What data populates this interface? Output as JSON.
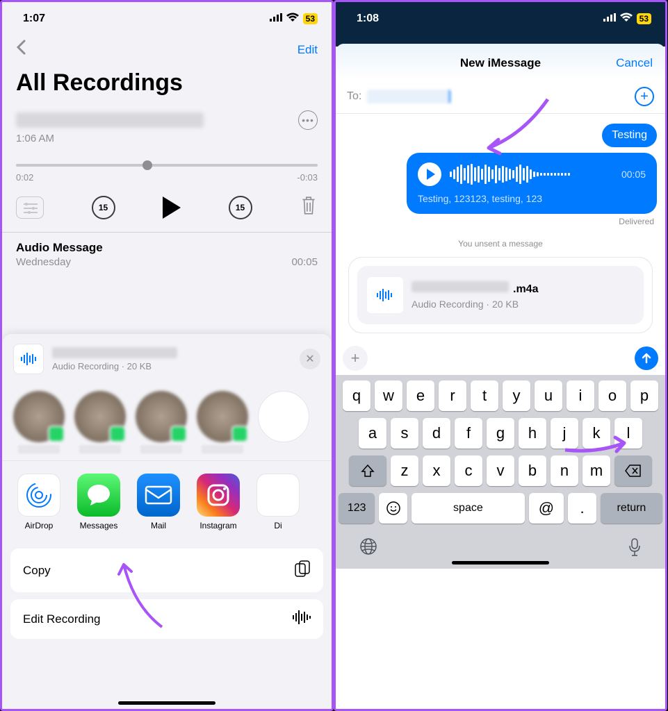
{
  "left": {
    "status": {
      "time": "1:07",
      "battery": "53"
    },
    "nav": {
      "edit": "Edit"
    },
    "title": "All Recordings",
    "current_recording": {
      "time": "1:06 AM",
      "elapsed": "0:02",
      "remaining": "-0:03",
      "skip_back": "15",
      "skip_fwd": "15"
    },
    "second_recording": {
      "title": "Audio Message",
      "day": "Wednesday",
      "duration": "00:05"
    },
    "share": {
      "file_subtitle": "Audio Recording · 20 KB",
      "apps": {
        "airdrop": "AirDrop",
        "messages": "Messages",
        "mail": "Mail",
        "instagram": "Instagram",
        "partial": "Di"
      },
      "actions": {
        "copy": "Copy",
        "edit": "Edit Recording"
      }
    }
  },
  "right": {
    "status": {
      "time": "1:08",
      "battery": "53"
    },
    "nav": {
      "title": "New iMessage",
      "cancel": "Cancel"
    },
    "to_label": "To:",
    "chat": {
      "bubble1": "Testing",
      "audio_duration": "00:05",
      "transcript": "Testing, 123123, testing, 123",
      "delivered": "Delivered",
      "unsent": "You unsent a message"
    },
    "attachment": {
      "extension": ".m4a",
      "subtitle": "Audio Recording · 20 KB"
    },
    "keyboard": {
      "row1": [
        "q",
        "w",
        "e",
        "r",
        "t",
        "y",
        "u",
        "i",
        "o",
        "p"
      ],
      "row2": [
        "a",
        "s",
        "d",
        "f",
        "g",
        "h",
        "j",
        "k",
        "l"
      ],
      "row3": [
        "z",
        "x",
        "c",
        "v",
        "b",
        "n",
        "m"
      ],
      "numkey": "123",
      "space": "space",
      "at": "@",
      "dot": ".",
      "return": "return"
    }
  }
}
